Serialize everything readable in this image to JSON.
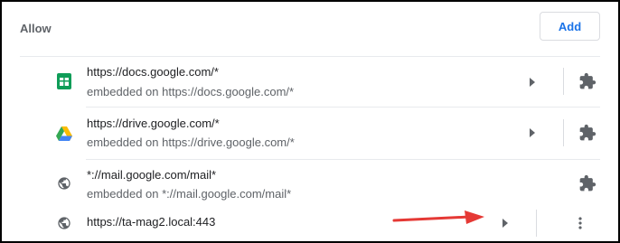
{
  "section": {
    "label": "Allow"
  },
  "add_button": {
    "label": "Add"
  },
  "colors": {
    "accent": "#1a73e8",
    "annotation_arrow": "#e53935",
    "docs_green": "#0f9d58",
    "drive_yellow": "#fbbc04",
    "drive_green": "#34a853",
    "drive_blue": "#4285f4",
    "icon_gray": "#5f6368"
  },
  "sites": [
    {
      "url": "https://docs.google.com/*",
      "embedded": "embedded on https://docs.google.com/*",
      "icon": "google-sheets-icon",
      "has_arrow": true,
      "trailing": "puzzle-piece-icon"
    },
    {
      "url": "https://drive.google.com/*",
      "embedded": "embedded on https://drive.google.com/*",
      "icon": "google-drive-icon",
      "has_arrow": true,
      "trailing": "puzzle-piece-icon"
    },
    {
      "url": "*://mail.google.com/mail*",
      "embedded": "embedded on *://mail.google.com/mail*",
      "icon": "globe-icon",
      "has_arrow": false,
      "trailing": "puzzle-piece-icon"
    },
    {
      "url": "https://ta-mag2.local:443",
      "embedded": "",
      "icon": "globe-icon",
      "has_arrow": true,
      "trailing": "more-vert-icon"
    }
  ]
}
